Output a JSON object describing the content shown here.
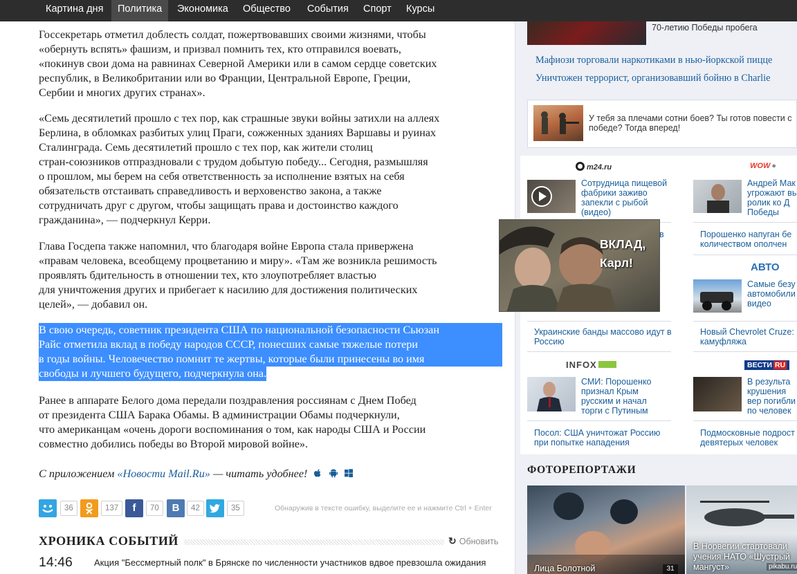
{
  "nav": {
    "items": [
      "Картина дня",
      "Политика",
      "Экономика",
      "Общество",
      "События",
      "Спорт",
      "Курсы"
    ],
    "active": "Политика"
  },
  "article": {
    "p1": [
      "Госсекретарь отметил доблесть солдат, пожертвовавших своими жизнями, чтобы",
      "«обернуть вспять» фашизм, и призвал помнить тех, кто отправился воевать,",
      "«покинув свои дома на равнинах Северной Америки или в самом сердце советских",
      "республик, в Великобритании или во Франции, Центральной Европе, Греции,",
      "Сербии и многих других странах»."
    ],
    "p2": [
      "«Семь десятилетий прошло с тех пор, как страшные звуки войны затихли на аллеях",
      "Берлина, в обломках разбитых улиц Праги, сожженных зданиях Варшавы и руинах",
      "Сталинграда. Семь десятилетий прошло с тех пор, как жители столиц",
      "стран-союзников отпраздновали с трудом добытую победу... Сегодня, размышляя",
      "о прошлом, мы берем на себя ответственность за исполнение взятых на себя",
      "обязательств отстаивать справедливость и верховенство закона, а также",
      "сотрудничать друг с другом, чтобы защищать права и достоинство каждого",
      "гражданина», — подчеркнул Керри."
    ],
    "p3": [
      "Глава Госдепа также напомнил, что благодаря войне Европа стала привержена",
      "«правам человека, всеобщему процветанию и миру». «Там же возникла решимость",
      "проявлять бдительность в отношении тех, кто злоупотребляет властью",
      "для уничтожения других и прибегает к насилию для достижения политических",
      "целей», — добавил он."
    ],
    "p4": [
      "В свою очередь, советник президента США по национальной безопасности Сьюзан",
      "Райс отметила вклад в победу народов СССР, понесших самые тяжелые потери",
      "в годы войны. Человечество помнит те жертвы, которые были принесены во имя",
      "свободы и лучшего будущего, подчеркнула она."
    ],
    "p5": [
      "Ранее в аппарате Белого дома передали поздравления россиянам с Днем Побед",
      "от президента США Барака Обамы. В администрации Обамы подчеркнули,",
      "что американцам «очень дороги воспоминания о том, как народы США и России",
      "совместно добились победы во Второй мировой войне»."
    ],
    "app_prefix": "С приложением ",
    "app_link": "«Новости Mail.Ru»",
    "app_suffix": " — читать удобнее!"
  },
  "share": {
    "counts": [
      "36",
      "137",
      "70",
      "42",
      "35"
    ],
    "error_note": "Обнаружив в тексте ошибку, выделите ее и нажмите Ctrl + Enter"
  },
  "chronicle": {
    "title": "ХРОНИКА СОБЫТИЙ",
    "refresh": "Обновить",
    "time": "14:46",
    "text": "Акция \"Бессмертный полк\" в Брянске по численности участников вдвое превзошла ожидания"
  },
  "right": {
    "top_caption": "70-летию Победы пробега",
    "link1": "Мафиози торговали наркотиками в нью-йоркской пицце",
    "link2": "Уничтожен террорист, организовавший бойню в Charlie",
    "ad_text": "У тебя за плечами сотни боев? Ты готов повести с победе? Тогда вперед!",
    "m24_logo": "m24.ru",
    "m24_text": "Сотрудница пищевой фабрики заживо запекли с рыбой (видео)",
    "wow_logo": "WOW",
    "wow_text": "Андрей Мак угрожают вы ролик ко Д Победы",
    "r_hidden": "в",
    "right_mid_text": "Порошенко напуган бе количеством ополчен",
    "avto": "АВТО",
    "avto_text": "Самые безу автомобили видео",
    "ukr_text": "Украинские банды массово идут в Россию",
    "chevy_text": "Новый Chevrolet Cruze: камуфляжа",
    "infox_logo": "INFOX",
    "infox_text": "СМИ: Порошенко признал Крым русским и начал торги с Путиным",
    "vesti_logo": "ВЕСТИ",
    "vesti_text": "В результа крушения вер погибли по человек",
    "posol_text": "Посол: США уничтожат Россию при попытке нападения",
    "podmos_text": "Подмосковные подрост девятерых человек",
    "foto_title": "ФОТОРЕПОРТАЖИ",
    "photo1_caption": "Лица Болотной",
    "photo1_count": "31",
    "photo2_caption": "В Норвегии стартовали учения НАТО «Шустрый мангуст»"
  },
  "meme": {
    "caption": "ВКЛАД, Карл!"
  },
  "watermark": "pikabu.ru"
}
